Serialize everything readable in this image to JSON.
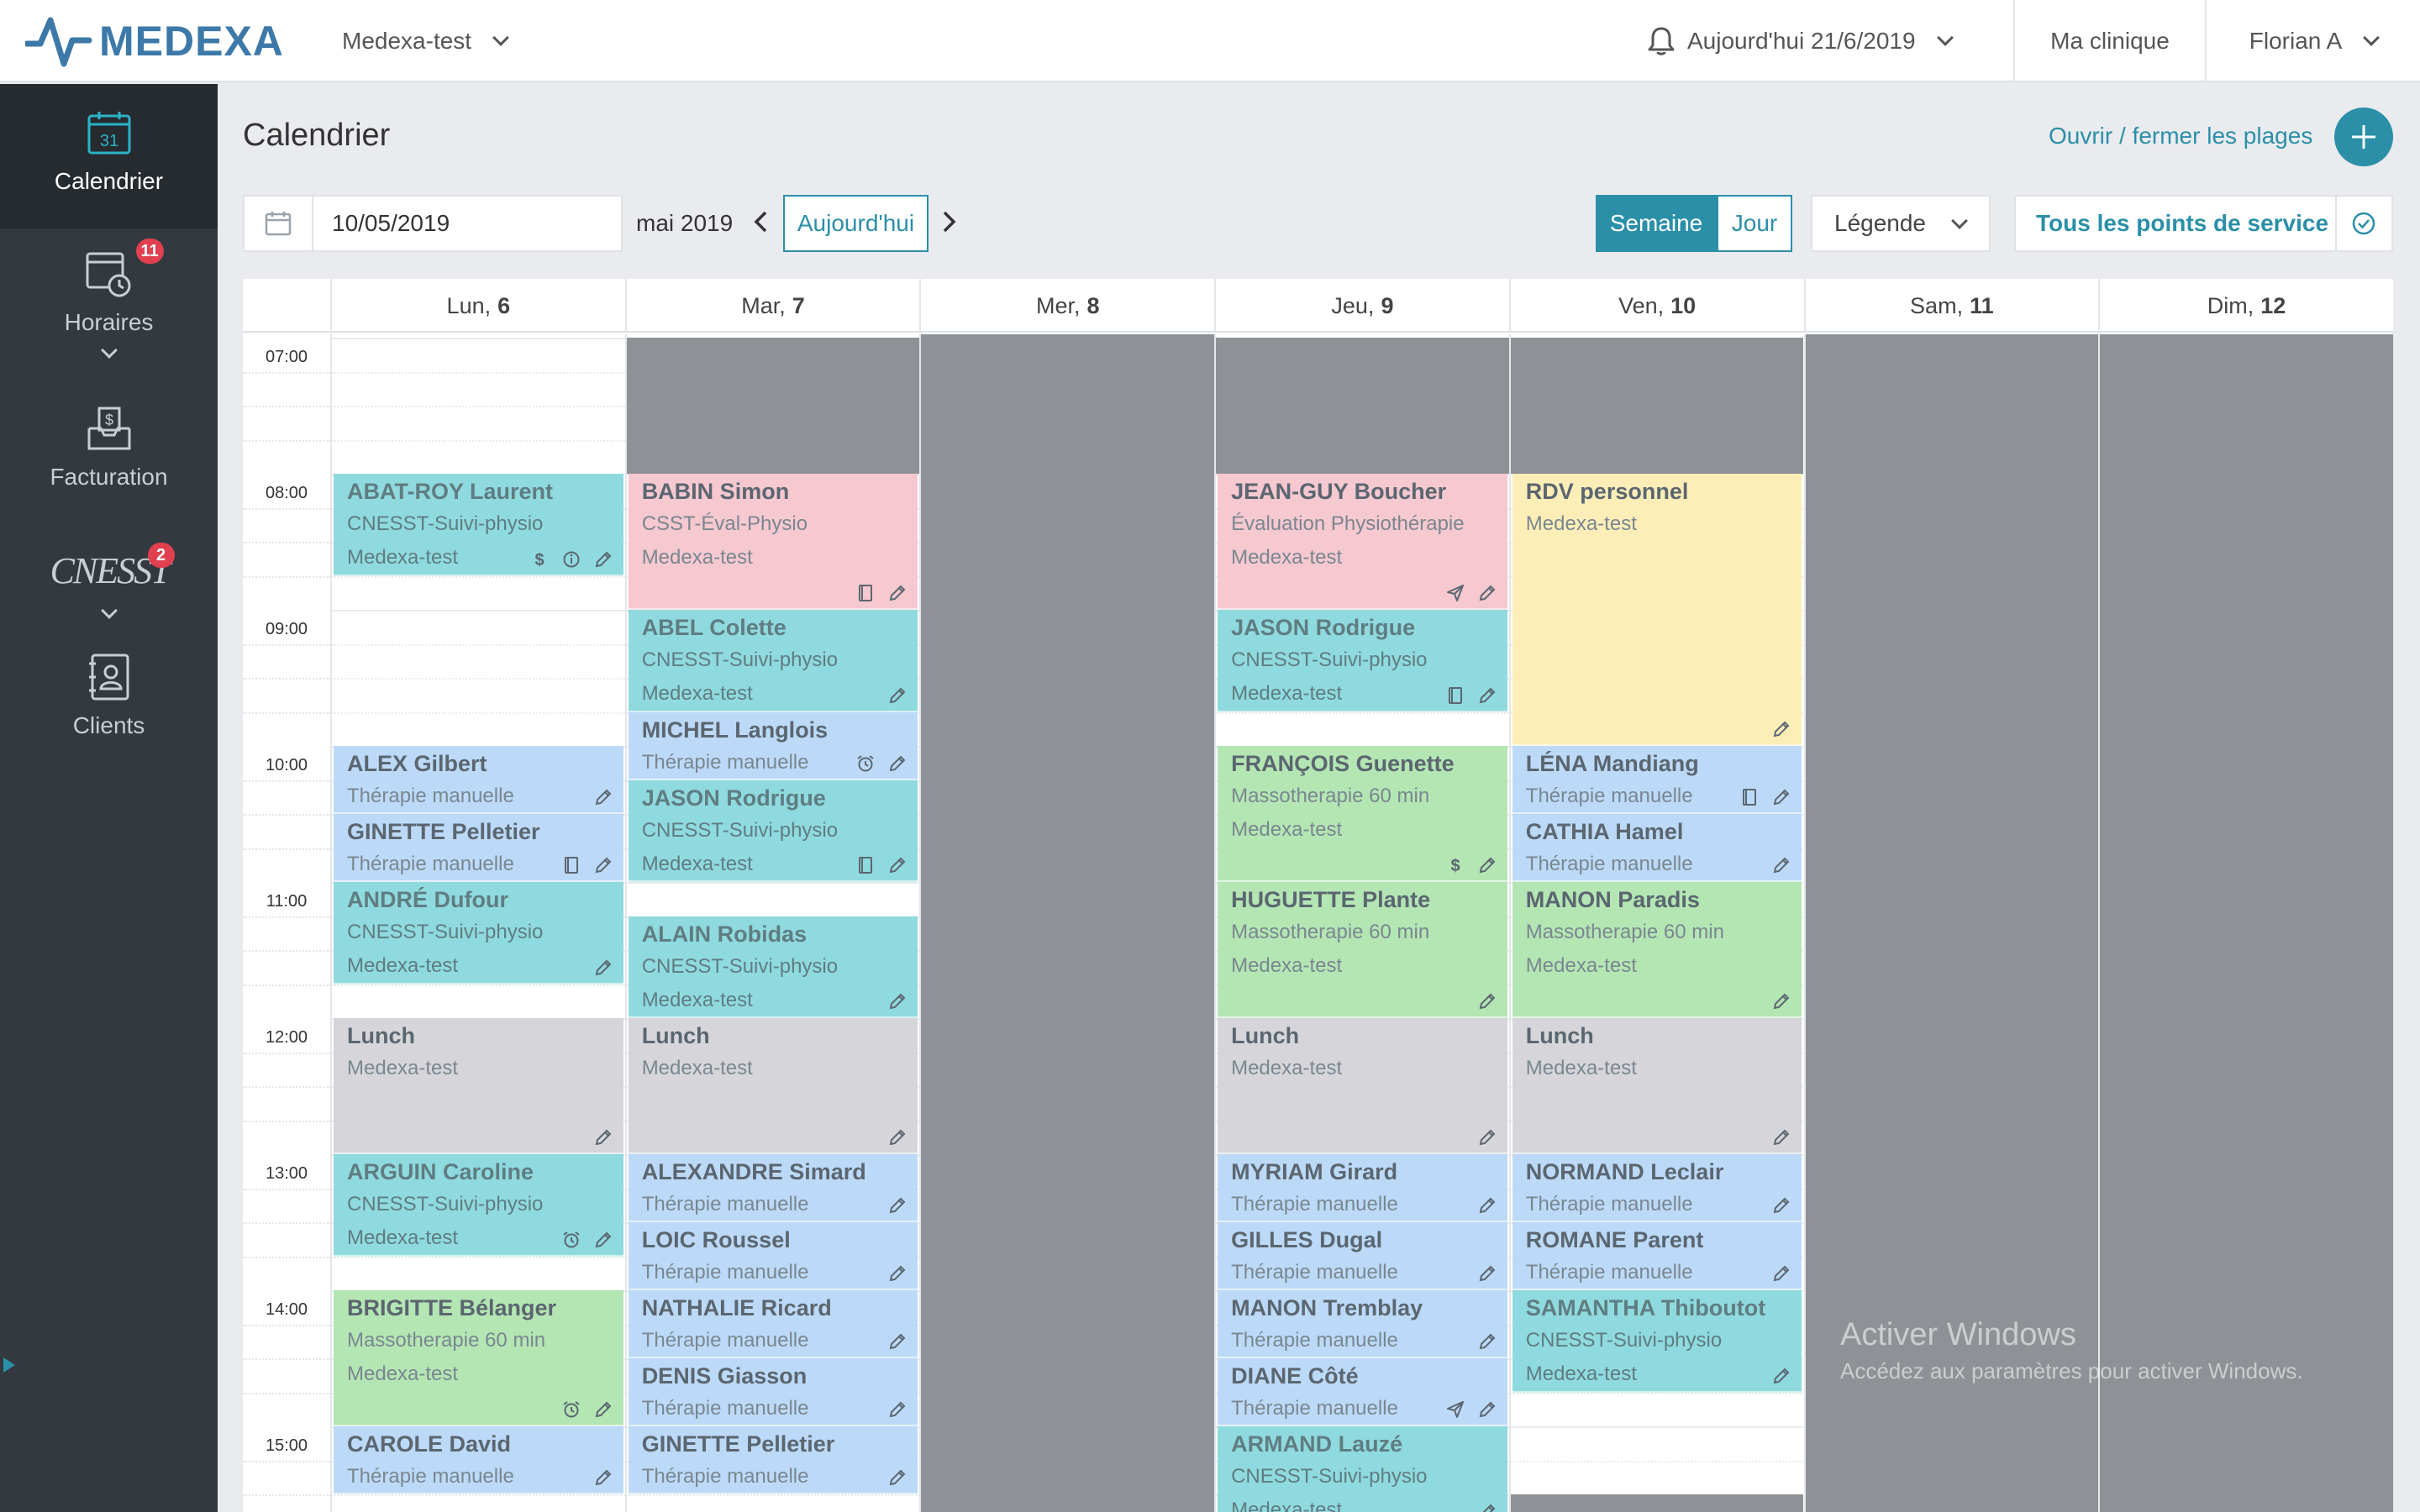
{
  "header": {
    "logo_text": "MEDEXA",
    "clinic_name": "Medexa-test",
    "today_label": "Aujourd'hui 21/6/2019",
    "my_clinic": "Ma clinique",
    "user_name": "Florian A"
  },
  "sidebar": {
    "items": [
      {
        "label": "Calendrier",
        "icon": "calendar-icon",
        "icon_text": "31",
        "active": true
      },
      {
        "label": "Horaires",
        "icon": "schedule-icon",
        "badge": "11"
      },
      {
        "label": "Facturation",
        "icon": "billing-icon"
      },
      {
        "label": "",
        "icon": "cnesst-logo",
        "logo_text": "CNESST",
        "badge": "2"
      },
      {
        "label": "Clients",
        "icon": "clients-icon"
      }
    ]
  },
  "page": {
    "title": "Calendrier",
    "open_close_link": "Ouvrir / fermer les plages"
  },
  "toolbar": {
    "date_value": "10/05/2019",
    "month_label": "mai 2019",
    "today_button": "Aujourd'hui",
    "week_button": "Semaine",
    "day_button": "Jour",
    "legend_label": "Légende",
    "service_points": "Tous les points de service"
  },
  "calendar": {
    "days": [
      {
        "name": "Lun,",
        "num": "6",
        "open": true
      },
      {
        "name": "Mar,",
        "num": "7",
        "open": true
      },
      {
        "name": "Mer,",
        "num": "8",
        "open": false
      },
      {
        "name": "Jeu,",
        "num": "9",
        "open": true
      },
      {
        "name": "Ven,",
        "num": "10",
        "open": true
      },
      {
        "name": "Sam,",
        "num": "11",
        "open": false
      },
      {
        "name": "Dim,",
        "num": "12",
        "open": false
      }
    ],
    "times": [
      "07:00",
      "08:00",
      "09:00",
      "10:00",
      "11:00",
      "12:00",
      "13:00",
      "14:00",
      "15:00"
    ],
    "appointments": [
      {
        "day": 0,
        "start": "8:00",
        "end": "8:45",
        "color": "teal",
        "name": "ABAT-ROY Laurent",
        "type": "CNESST-Suivi-physio",
        "loc": "Medexa-test",
        "icons": [
          "dollar",
          "info",
          "pencil"
        ]
      },
      {
        "day": 0,
        "start": "10:00",
        "end": "10:30",
        "color": "blue",
        "name": "ALEX Gilbert",
        "type": "Thérapie manuelle",
        "icons": [
          "pencil"
        ]
      },
      {
        "day": 0,
        "start": "10:30",
        "end": "11:00",
        "color": "blue",
        "name": "GINETTE Pelletier",
        "type": "Thérapie manuelle",
        "icons": [
          "doc",
          "pencil"
        ]
      },
      {
        "day": 0,
        "start": "11:00",
        "end": "11:45",
        "color": "teal",
        "name": "ANDRÉ Dufour",
        "type": "CNESST-Suivi-physio",
        "loc": "Medexa-test",
        "icons": [
          "pencil"
        ]
      },
      {
        "day": 0,
        "start": "12:00",
        "end": "13:00",
        "color": "grey",
        "name": "Lunch",
        "type": "Medexa-test",
        "icons": [
          "pencil"
        ]
      },
      {
        "day": 0,
        "start": "13:00",
        "end": "13:45",
        "color": "teal",
        "name": "ARGUIN Caroline",
        "type": "CNESST-Suivi-physio",
        "loc": "Medexa-test",
        "icons": [
          "alarm",
          "pencil"
        ]
      },
      {
        "day": 0,
        "start": "14:00",
        "end": "15:00",
        "color": "green",
        "name": "BRIGITTE Bélanger",
        "type": "Massotherapie 60 min",
        "loc": "Medexa-test",
        "icons": [
          "alarm",
          "pencil"
        ]
      },
      {
        "day": 0,
        "start": "15:00",
        "end": "15:30",
        "color": "blue",
        "name": "CAROLE David",
        "type": "Thérapie manuelle",
        "icons": [
          "pencil"
        ]
      },
      {
        "day": 1,
        "start": "8:00",
        "end": "9:00",
        "color": "pink",
        "name": "BABIN Simon",
        "type": "CSST-Éval-Physio",
        "loc": "Medexa-test",
        "icons": [
          "doc",
          "pencil"
        ]
      },
      {
        "day": 1,
        "start": "9:00",
        "end": "9:45",
        "color": "teal",
        "name": "ABEL Colette",
        "type": "CNESST-Suivi-physio",
        "loc": "Medexa-test",
        "icons": [
          "pencil"
        ]
      },
      {
        "day": 1,
        "start": "9:45",
        "end": "10:15",
        "color": "blue",
        "name": "MICHEL Langlois",
        "type": "Thérapie manuelle",
        "icons": [
          "alarm",
          "pencil"
        ]
      },
      {
        "day": 1,
        "start": "10:15",
        "end": "11:00",
        "color": "teal",
        "name": "JASON Rodrigue",
        "type": "CNESST-Suivi-physio",
        "loc": "Medexa-test",
        "icons": [
          "doc",
          "pencil"
        ]
      },
      {
        "day": 1,
        "start": "11:15",
        "end": "12:00",
        "color": "teal",
        "name": "ALAIN Robidas",
        "type": "CNESST-Suivi-physio",
        "loc": "Medexa-test",
        "icons": [
          "pencil"
        ]
      },
      {
        "day": 1,
        "start": "12:00",
        "end": "13:00",
        "color": "grey",
        "name": "Lunch",
        "type": "Medexa-test",
        "icons": [
          "pencil"
        ]
      },
      {
        "day": 1,
        "start": "13:00",
        "end": "13:30",
        "color": "blue",
        "name": "ALEXANDRE Simard",
        "type": "Thérapie manuelle",
        "icons": [
          "pencil"
        ]
      },
      {
        "day": 1,
        "start": "13:30",
        "end": "14:00",
        "color": "blue",
        "name": "LOIC Roussel",
        "type": "Thérapie manuelle",
        "icons": [
          "pencil"
        ]
      },
      {
        "day": 1,
        "start": "14:00",
        "end": "14:30",
        "color": "blue",
        "name": "NATHALIE Ricard",
        "type": "Thérapie manuelle",
        "icons": [
          "pencil"
        ]
      },
      {
        "day": 1,
        "start": "14:30",
        "end": "15:00",
        "color": "blue",
        "name": "DENIS Giasson",
        "type": "Thérapie manuelle",
        "icons": [
          "pencil"
        ]
      },
      {
        "day": 1,
        "start": "15:00",
        "end": "15:30",
        "color": "blue",
        "name": "GINETTE Pelletier",
        "type": "Thérapie manuelle",
        "icons": [
          "pencil"
        ]
      },
      {
        "day": 3,
        "start": "8:00",
        "end": "9:00",
        "color": "pink",
        "name": "JEAN-GUY Boucher",
        "type": "Évaluation Physiothérapie",
        "loc": "Medexa-test",
        "icons": [
          "send",
          "pencil"
        ]
      },
      {
        "day": 3,
        "start": "9:00",
        "end": "9:45",
        "color": "teal",
        "name": "JASON Rodrigue",
        "type": "CNESST-Suivi-physio",
        "loc": "Medexa-test",
        "icons": [
          "doc",
          "pencil"
        ]
      },
      {
        "day": 3,
        "start": "10:00",
        "end": "11:00",
        "color": "green",
        "name": "FRANÇOIS Guenette",
        "type": "Massotherapie 60 min",
        "loc": "Medexa-test",
        "icons": [
          "dollar",
          "pencil"
        ]
      },
      {
        "day": 3,
        "start": "11:00",
        "end": "12:00",
        "color": "green",
        "name": "HUGUETTE Plante",
        "type": "Massotherapie 60 min",
        "loc": "Medexa-test",
        "icons": [
          "pencil"
        ]
      },
      {
        "day": 3,
        "start": "12:00",
        "end": "13:00",
        "color": "grey",
        "name": "Lunch",
        "type": "Medexa-test",
        "icons": [
          "pencil"
        ]
      },
      {
        "day": 3,
        "start": "13:00",
        "end": "13:30",
        "color": "blue",
        "name": "MYRIAM Girard",
        "type": "Thérapie manuelle",
        "icons": [
          "pencil"
        ]
      },
      {
        "day": 3,
        "start": "13:30",
        "end": "14:00",
        "color": "blue",
        "name": "GILLES Dugal",
        "type": "Thérapie manuelle",
        "icons": [
          "pencil"
        ]
      },
      {
        "day": 3,
        "start": "14:00",
        "end": "14:30",
        "color": "blue",
        "name": "MANON Tremblay",
        "type": "Thérapie manuelle",
        "icons": [
          "pencil"
        ]
      },
      {
        "day": 3,
        "start": "14:30",
        "end": "15:00",
        "color": "blue",
        "name": "DIANE Côté",
        "type": "Thérapie manuelle",
        "icons": [
          "send",
          "pencil"
        ]
      },
      {
        "day": 3,
        "start": "15:00",
        "end": "15:45",
        "color": "teal",
        "name": "ARMAND Lauzé",
        "type": "CNESST-Suivi-physio",
        "loc": "Medexa-test",
        "icons": [
          "pencil"
        ]
      },
      {
        "day": 4,
        "start": "8:00",
        "end": "10:00",
        "color": "yellow",
        "name": "RDV personnel",
        "type": "Medexa-test",
        "icons": [
          "pencil"
        ]
      },
      {
        "day": 4,
        "start": "10:00",
        "end": "10:30",
        "color": "blue",
        "name": "LÉNA Mandiang",
        "type": "Thérapie manuelle",
        "icons": [
          "doc",
          "pencil"
        ]
      },
      {
        "day": 4,
        "start": "10:30",
        "end": "11:00",
        "color": "blue",
        "name": "CATHIA Hamel",
        "type": "Thérapie manuelle",
        "icons": [
          "pencil"
        ]
      },
      {
        "day": 4,
        "start": "11:00",
        "end": "12:00",
        "color": "green",
        "name": "MANON Paradis",
        "type": "Massotherapie 60 min",
        "loc": "Medexa-test",
        "icons": [
          "pencil"
        ]
      },
      {
        "day": 4,
        "start": "12:00",
        "end": "13:00",
        "color": "grey",
        "name": "Lunch",
        "type": "Medexa-test",
        "icons": [
          "pencil"
        ]
      },
      {
        "day": 4,
        "start": "13:00",
        "end": "13:30",
        "color": "blue",
        "name": "NORMAND Leclair",
        "type": "Thérapie manuelle",
        "icons": [
          "pencil"
        ]
      },
      {
        "day": 4,
        "start": "13:30",
        "end": "14:00",
        "color": "blue",
        "name": "ROMANE Parent",
        "type": "Thérapie manuelle",
        "icons": [
          "pencil"
        ]
      },
      {
        "day": 4,
        "start": "14:00",
        "end": "14:45",
        "color": "teal",
        "name": "SAMANTHA Thiboutot",
        "type": "CNESST-Suivi-physio",
        "loc": "Medexa-test",
        "icons": [
          "pencil"
        ]
      }
    ],
    "closed_ranges": [
      {
        "day": 1,
        "start": "7:00",
        "end": "8:00"
      },
      {
        "day": 3,
        "start": "7:00",
        "end": "8:00"
      },
      {
        "day": 4,
        "start": "7:00",
        "end": "8:00"
      },
      {
        "day": 4,
        "start": "15:30",
        "end": "16:00"
      }
    ]
  },
  "watermark": {
    "line1": "Activer Windows",
    "line2": "Accédez aux paramètres pour activer Windows."
  },
  "colors": {
    "accent": "#2b8fa8",
    "teal": "#8fdadf",
    "pink": "#f6c8d0",
    "blue": "#bcdaf8",
    "green": "#b4e6b4",
    "yellow": "#fdeeb8",
    "grey": "#d6d6da",
    "closed": "#8e9196"
  }
}
